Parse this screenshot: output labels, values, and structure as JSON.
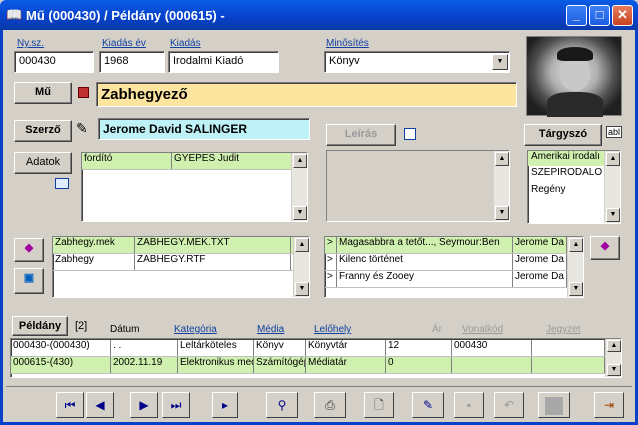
{
  "window": {
    "title": "Mű (000430) / Példány (000615) -",
    "min": "_",
    "max": "□",
    "close": "✕"
  },
  "fields": {
    "nysz_label": "Ny.sz.",
    "nysz_value": "000430",
    "kiadas_ev_label": "Kiadás év",
    "kiadas_ev_value": "1968",
    "kiadas_label": "Kiadás",
    "kiadas_value": "Irodalmi Kiadó",
    "minosites_label": "Minősítés",
    "minosites_value": "Könyv"
  },
  "mu": {
    "button": "Mű",
    "title": "Zabhegyező"
  },
  "szerzo": {
    "button": "Szerző",
    "name": "Jerome David SALINGER"
  },
  "leiras": {
    "button": "Leírás"
  },
  "targyszo": {
    "button": "Tárgyszó",
    "items": [
      "Amerikai irodalı",
      "SZÉPIRODALO",
      "Regény"
    ]
  },
  "adatok": {
    "button": "Adatok",
    "rows": [
      [
        "fordító",
        "GYEPES Judit"
      ]
    ]
  },
  "files": {
    "rows": [
      [
        "Zabhegy.mek",
        "ZABHEGY.MEK.TXT"
      ],
      [
        "Zabhegy",
        "ZABHEGY.RTF"
      ]
    ]
  },
  "related": {
    "rows": [
      [
        ">",
        "Magasabbra a tetőt..., Seymour:Ben",
        "Jerome Da"
      ],
      [
        ">",
        "Kilenc történet",
        "Jerome Da"
      ],
      [
        ">",
        "Franny és Zooey",
        "Jerome Da"
      ]
    ]
  },
  "peldany": {
    "button": "Példány",
    "count": "[2]",
    "headers": [
      "Dátum",
      "Kategória",
      "Média",
      "Lelőhely",
      "Ár",
      "Vonalkód",
      "Jegyzet"
    ],
    "rows": [
      [
        "000430-(000430)",
        "  .  .",
        "Leltárköteles",
        "Könyv",
        "Könyvtár",
        "12",
        "000430",
        ""
      ],
      [
        "000615-(430)",
        "2002.11.19",
        "Elektronikus medi",
        "Számítógép",
        "Médiatár",
        "0",
        "",
        ""
      ]
    ]
  },
  "nav": [
    "⏮",
    "◀",
    "▶",
    "⏭",
    "▸"
  ]
}
